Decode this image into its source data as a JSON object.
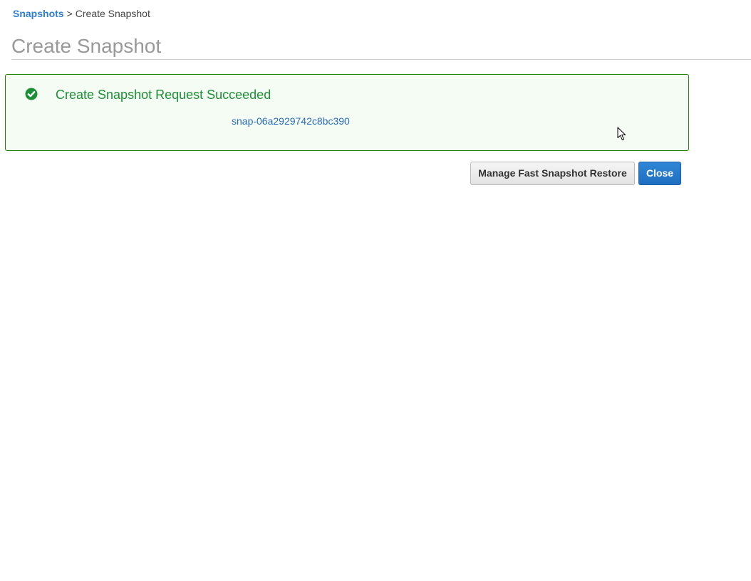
{
  "breadcrumb": {
    "parent_label": "Snapshots",
    "separator": ">",
    "current_label": "Create Snapshot"
  },
  "page": {
    "title": "Create Snapshot"
  },
  "alert": {
    "status": "success",
    "icon": "check-circle-icon",
    "title": "Create Snapshot Request Succeeded",
    "snapshot_id": "snap-06a2929742c8bc390"
  },
  "actions": {
    "manage_fast_snapshot_restore_label": "Manage Fast Snapshot Restore",
    "close_label": "Close"
  },
  "colors": {
    "link": "#2f7fd1",
    "success": "#1d8f36",
    "success_background": "#f4fcf3",
    "primary_button": "#1f6ebf",
    "title_gray": "#999999"
  }
}
